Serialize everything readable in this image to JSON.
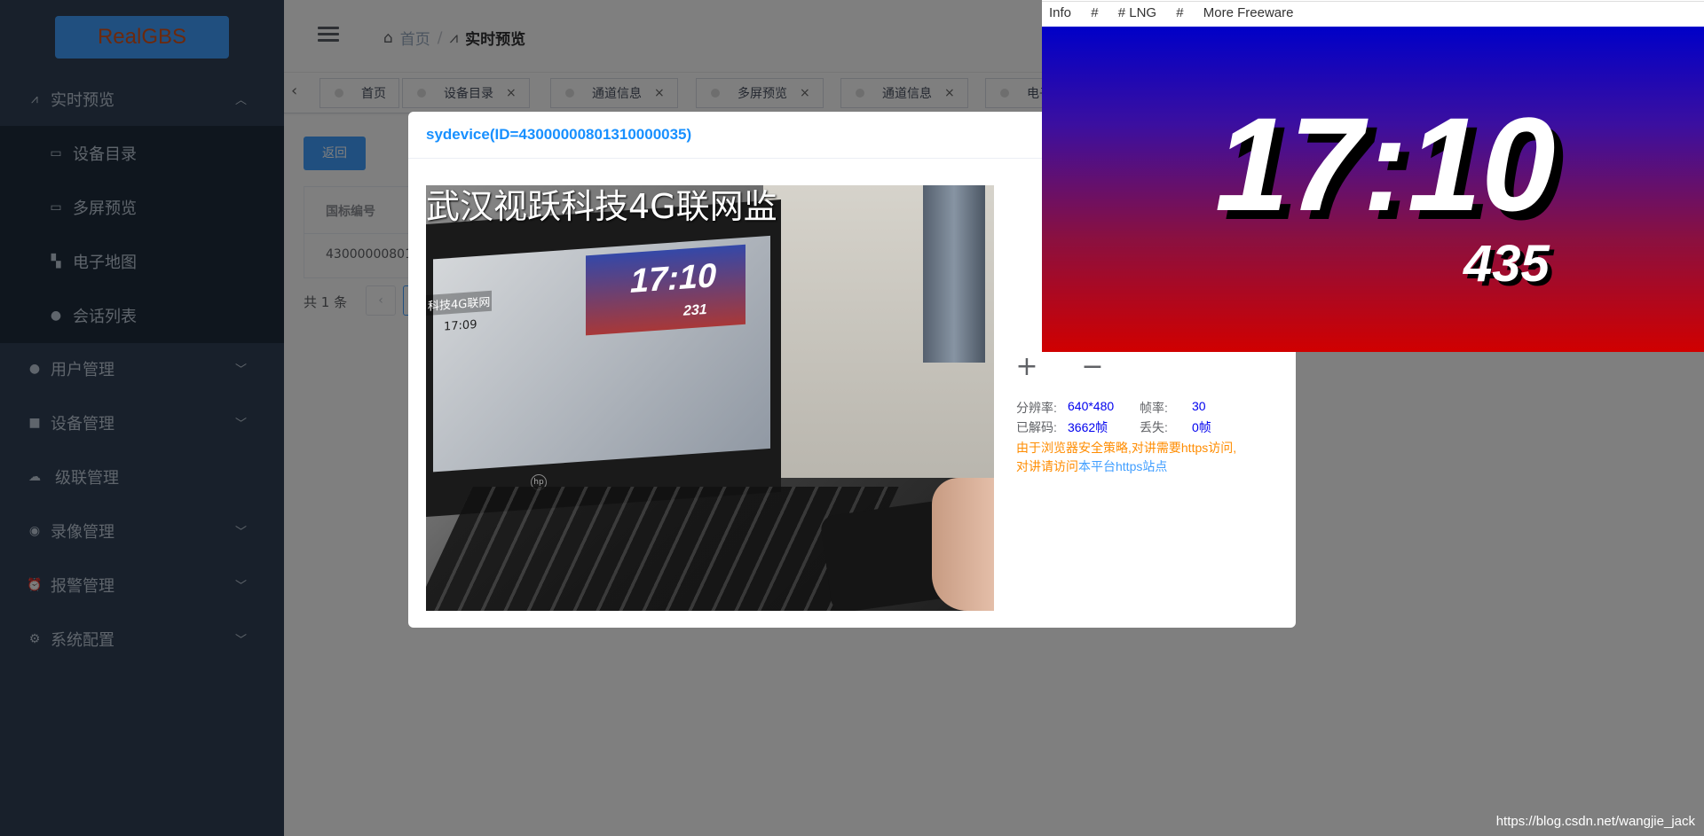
{
  "sidebar": {
    "logo": "RealGBS",
    "items": [
      {
        "label": "实时预览",
        "icon": "pulse-icon",
        "arrow": "chevron-up-icon"
      },
      {
        "label": "设备目录",
        "icon": "folder-icon"
      },
      {
        "label": "多屏预览",
        "icon": "folder-icon"
      },
      {
        "label": "电子地图",
        "icon": "map-icon"
      },
      {
        "label": "会话列表",
        "icon": "chat-icon"
      },
      {
        "label": "用户管理",
        "icon": "user-icon",
        "arrow": "chevron-down-icon"
      },
      {
        "label": "设备管理",
        "icon": "camera-icon",
        "arrow": "chevron-down-icon"
      },
      {
        "label": "级联管理",
        "icon": "cloud-icon"
      },
      {
        "label": "录像管理",
        "icon": "record-icon",
        "arrow": "chevron-down-icon"
      },
      {
        "label": "报警管理",
        "icon": "alarm-clock-icon",
        "arrow": "chevron-down-icon"
      },
      {
        "label": "系统配置",
        "icon": "gear-icon",
        "arrow": "chevron-down-icon"
      }
    ]
  },
  "header": {
    "breadcrumb": [
      "首页",
      "/",
      "实时预览"
    ]
  },
  "tags": [
    {
      "label": "首页",
      "closable": false
    },
    {
      "label": "设备目录",
      "closable": true
    },
    {
      "label": "通道信息",
      "closable": true
    },
    {
      "label": "多屏预览",
      "closable": true
    },
    {
      "label": "通道信息",
      "closable": true
    },
    {
      "label": "电子地图",
      "closable": false
    }
  ],
  "content": {
    "back_button": "返回",
    "table_header": "国标编号",
    "table_cell": "43000000801",
    "total": "共 1 条"
  },
  "dialog": {
    "title": "sydevice(ID=43000000801310000035)",
    "video_osd": "武汉视跃科技4G联网监",
    "inner_clock_time": "17:10",
    "inner_clock_frame": "231",
    "inner_osd": "科技4G联网",
    "inner_osd_time": "17:09",
    "ptz_plus": "+",
    "ptz_minus": "−",
    "stats": {
      "resolution_label": "分辨率:",
      "resolution_value": "640*480",
      "fps_label": "帧率:",
      "fps_value": "30",
      "decoded_label": "已解码:",
      "decoded_value": "3662帧",
      "lost_label": "丢失:",
      "lost_value": "0帧"
    },
    "warning": "由于浏览器安全策略,对讲需要https访问,",
    "warning2_prefix": "对讲请访问",
    "warning2_link": "本平台https站点"
  },
  "clock_window": {
    "menu": [
      "Info",
      "#",
      "# LNG",
      "#",
      "More Freeware"
    ],
    "time": "17:10",
    "frame": "435"
  },
  "watermark": "https://blog.csdn.net/wangjie_jack",
  "colors": {
    "sidebar_bg": "#304156",
    "accent": "#409eff",
    "title_blue": "#1890ff",
    "warning_orange": "#ff8c00"
  }
}
